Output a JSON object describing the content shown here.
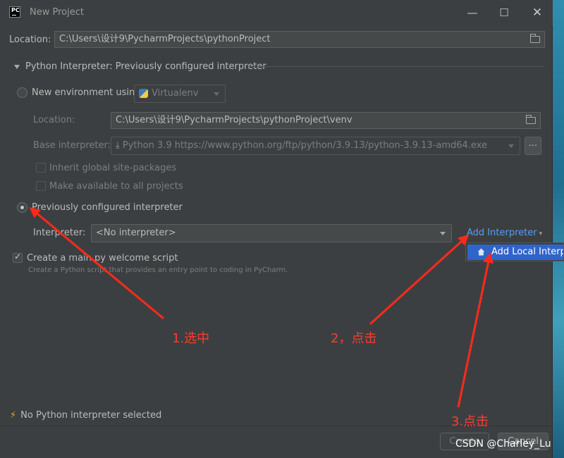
{
  "window": {
    "title": "New Project",
    "controls": [
      "—",
      "☐",
      "✕"
    ]
  },
  "location": {
    "label": "Location:",
    "value": "C:\\Users\\设计9\\PycharmProjects\\pythonProject"
  },
  "interpreter_section": {
    "header": "Python Interpreter: Previously configured interpreter"
  },
  "new_env": {
    "radio_label": "New environment using",
    "env_type": "Virtualenv",
    "location_label": "Location:",
    "location_value": "C:\\Users\\设计9\\PycharmProjects\\pythonProject\\venv",
    "base_label": "Base interpreter:",
    "base_value": "Python 3.9 https://www.python.org/ftp/python/3.9.13/python-3.9.13-amd64.exe",
    "browse": "...",
    "inherit_label": "Inherit global site-packages",
    "make_available_label": "Make available to all projects"
  },
  "previous": {
    "radio_label": "Previously configured interpreter",
    "interpreter_label": "Interpreter:",
    "interpreter_value": "<No interpreter>",
    "add_interpreter": "Add Interpreter",
    "popup_item": "Add Local Interpreter..."
  },
  "welcome": {
    "checkbox_label": "Create a main.py welcome script",
    "hint": "Create a Python script that provides an entry point to coding in PyCharm."
  },
  "status": {
    "text": "No Python interpreter selected"
  },
  "buttons": {
    "create": "Create",
    "cancel": "Cancel"
  },
  "annotations": {
    "step1": "1.选中",
    "step2": "2，点击",
    "step3": "3.点击",
    "color": "#ff2a1a"
  },
  "watermark": "CSDN @Charley_Lu"
}
